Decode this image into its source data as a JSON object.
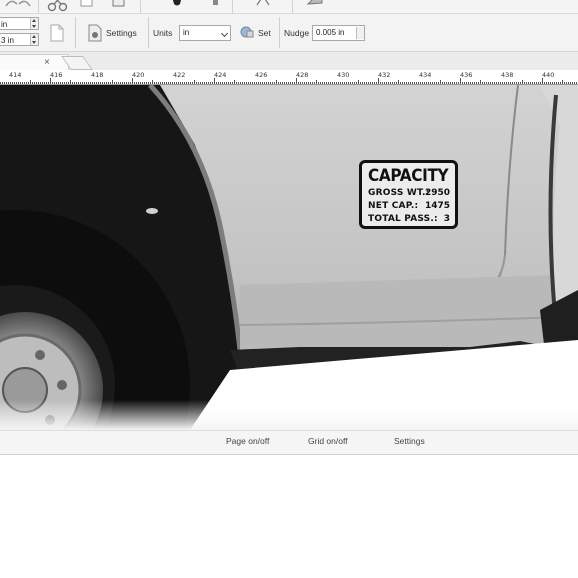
{
  "toolbar": {
    "icons": [
      "redo-icon",
      "cut-icon",
      "copy-icon",
      "paste-icon",
      "eyedropper-icon",
      "pen-tool-icon",
      "node-tool-icon",
      "zoom-icon"
    ]
  },
  "propbar": {
    "size_w_value": "in",
    "size_h_value": "3 in",
    "settings_label": "Settings",
    "units_label": "Units",
    "units_value": "in",
    "set_label": "Set",
    "nudge_label": "Nudge",
    "nudge_value": "0.005 in"
  },
  "tab": {
    "close_glyph": "×"
  },
  "ruler": {
    "labels": [
      "414",
      "416",
      "418",
      "420",
      "422",
      "424",
      "426",
      "428",
      "430",
      "432",
      "434",
      "436",
      "438",
      "440"
    ]
  },
  "decal": {
    "title": "CAPACITY",
    "rows": [
      {
        "label": "GROSS WT.:",
        "value": "2950"
      },
      {
        "label": "NET CAP.:",
        "value": "1475"
      },
      {
        "label": "TOTAL PASS.:",
        "value": "3"
      }
    ]
  },
  "bottombar": {
    "page_toggle": "Page on/off",
    "grid_toggle": "Grid on/off",
    "settings": "Settings"
  },
  "colors": {
    "truck_body": "#c9c9c9",
    "tire": "#0d0d0d",
    "decal_bg": "#ececec",
    "decal_border": "#111111"
  }
}
